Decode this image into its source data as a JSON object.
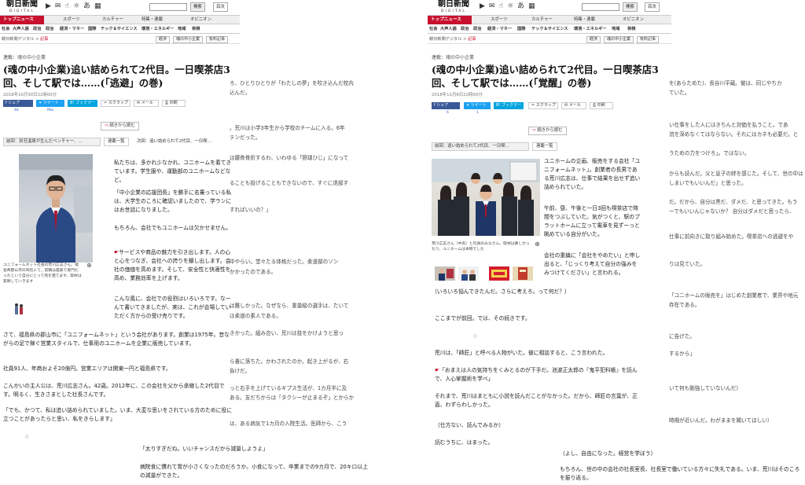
{
  "brand": {
    "name": "朝日新聞",
    "sub": "DIGITAL"
  },
  "header": {
    "search_button": "検索",
    "index_button": "目次",
    "icons": [
      "play-icon",
      "chat-icon",
      "hand-icon",
      "weather-icon",
      "font-size-icon",
      "grid-icon"
    ],
    "top_news": "トップニュース",
    "categories": [
      "スポーツ",
      "カルチャー",
      "特集・連載",
      "オピニオン"
    ],
    "subcategories": [
      "社会",
      "大声人語",
      "政治",
      "政治",
      "経済・マネー",
      "国際",
      "テック＆サイエンス",
      "環境・エネルギー",
      "地域",
      "将棋"
    ]
  },
  "breadcrumb": {
    "site": "朝日新聞デジタル",
    "sep": ">",
    "current": "記事"
  },
  "pills": [
    "経済",
    "魂の中小企業",
    "有料記事"
  ],
  "share": {
    "labels": [
      "シェア",
      "ツイート",
      "ブックマーク",
      "スクラップ",
      "メール",
      "印刷"
    ]
  },
  "continue": "続きから読む",
  "left": {
    "series": "連載：魂の中小企業",
    "title": "(魂の中小企業)追い詰められて2代目。一日喫茶店3回、そして駅では……(「逃避」の巻)",
    "date": "2018年10月30日22時00分",
    "counts": [
      "44",
      "Mai"
    ],
    "prev": "前回：別荘温泉が生んだベンチャー、…",
    "index": "連載一覧",
    "next": "次回：追い詰められて2代目、一日喫…",
    "caption": "ユニフォームネット社長の荒川広志さん。福島県郡山市の同社にて。前職は農家で専門だったという自分にとって売を建てます。取材は質問していきます",
    "paras": [
      "私たちは、多かれ少なかれ、ユニホームを着てきています。学生服や、運動部のユニホームなどなど。",
      "「中小企業の応援団長」を勝手に名乗っている私は、大学生のころに確認いましたので、学ランにはお世話になりました。",
      "もちろん、会社でもユニホームは欠かせません。",
      "サービスや商品の魅力を引き出します。人の心と心をつなぎ、会社への誇りを醸し出します。会社の価値を高めます。そして、安全性と快適性を高め、業務効率を上げます。",
      "こんな風に、会社での役割はいろいろです。なーんて書いてきましたが、実は、これが会場していただく方からの受け売りです。",
      "さて、福島県の郡山市に「ユニフォームネット」という会社があります。創業は1975年。昔ながらの足で稼ぐ営業スタイルで、仕事用のユニホームを企業に販売しています。",
      "社員91人、年商およそ20億円。営業エリアは関東一円と福島県です。",
      "こんかいの主人公は、荒川広志さん。42歳。2012年に、この会社を父から承継した2代目です。明るく、生きさまとした社長さんです。",
      "「でも、かつて、私は追い詰められていました。いま、大変な思いをされている方のために役に立つことがあったらと思い、私をきらします」",
      "「太りすぎだね。いいチャンスだから減量しようよ」",
      "病院食に慣れて胃が小さくなったのだろうか。小食になって、卒業までの9カ月で、20キロ以上の減量ができた。"
    ]
  },
  "middle_fragments": [
    "ろ、ひとりひとりが「わたしの夢」を吹き込んだ校内",
    "込んだ。",
    "。荒川は小学3年生から学校のチームに入る。6年",
    "テンだった。",
    "は腰骨骨折するわ、いわゆる「野球ひじ」になって",
    "ることも投げることもできないので、すぐに退部す",
    "すればいいの？」",
    "中やらい。堂々たる体格だった。柔道部のソン",
    "かかったのである。",
    "は難しかった。なぜなら、重量級の選手は、たいて",
    "は柔道の素人である。",
    "きかった。組み合い、荒川は技をかけようと思っ",
    "ら畳に落ちた。かわされたのか。起き上がるが、右",
    "負けだ。",
    "っと右手を上げているギプス生活が、1カ月半に及",
    "ある。友だちからは「タクシーが止まるぞ」とからか",
    "は、ある病気で1カ月の入院生活。医師から、こう"
  ],
  "right": {
    "series": "連載：魂の中小企業",
    "title": "(魂の中小企業)追い詰められて2代目。一日喫茶店3回、そして駅では……(「覚醒」の巻)",
    "date": "2018年11月6日22時00分",
    "counts": [
      "6",
      "1"
    ],
    "prev": "前回：追い詰められて2代目、一日喫…",
    "index": "連載一覧",
    "caption": "荒川広志さん（中央）と社員のみなさん。取材は楽しかったり、ユニホームは本物でした",
    "paras": [
      "ユニホームの企画、販売をする会社「ユニフォームネット」。創業者の長男である荒川広志は、仕事で結果を出せず追い詰められていた。",
      "午前、昼、午後と一日3回も喫茶店で時間をつぶしていた。気がつくと、駅のプラットホームに立って電車を見ずーっと眺めている自分がいた。",
      "会社の重鎮に「会社をやめたい」と申し出ると、「じっくり考えて自分の強みをみつけてください」と言われる。",
      "（いろいろ悩んできたんだ。さらに考えろ。って何だ？）",
      "ここまでが前回。では、その続きです。",
      "荒川は、「師匠」と呼べる人物がいた。彼に相談すると、こう言われた。",
      "「おまえは人の気持ちをくみとるのが下手だ。池波正太郎の『鬼平犯科帳』を読んで、人心掌握術を学べ」",
      "それまで、荒川はまともに小説を読んだことがなかった。だから、師匠の言葉が、正直、わずらわしかった。",
      "（仕方ない、読んでみるか）",
      "読むうちに、はまった。",
      "（よし、自由になった。経営を学ぼう）",
      "もちろん、世の中の会社の社長室長、社長室で働いている方々に失礼である。いま、荒川はそのころを振り返る。"
    ]
  },
  "right_fragments": [
    "を(あらためた)、長谷川平蔵。彼は、同じやちカ",
    "ていた。",
    "い仕事をした人にはきちんと対価を払うこと。であ",
    "流を深めなくてはならない。それにはカネも必要だ。と",
    "うための力をつけろ」。ではない。",
    "からも読んだ。父と息子の絆を感じた。そして、世の中は",
    "しまいでもいいんだ」と思った。",
    "だ。だから、自分は黒だ、ダメだ、と思ってきた。もう",
    "ーでもいいんじゃないか？ 自分はダメだと思ったら、",
    "仕事に前向きに取り組み始めた。喫茶店への逃避をや",
    "りは見ていた。",
    "「ユニホームの販売を」はじめた創業者で、業界や地元",
    "存在である。",
    "に告げた。",
    "するから」",
    "いて何も勉強していないんだ）",
    "時期が近いんだ。わがままを聞いてほしい）"
  ]
}
